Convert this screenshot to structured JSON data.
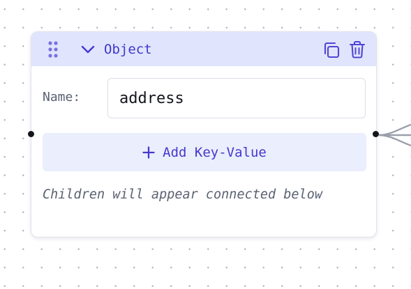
{
  "node": {
    "type_label": "Object",
    "name_label": "Name:",
    "name_value": "address",
    "add_button_label": "Add Key-Value",
    "hint": "Children will appear connected below"
  },
  "icons": {
    "drag": "drag-dots-icon",
    "collapse": "chevron-down-icon",
    "duplicate": "copy-icon",
    "delete": "trash-icon",
    "add": "plus-icon"
  },
  "colors": {
    "header_bg": "#e0e5fd",
    "accent": "#3f37c9",
    "button_bg": "#eaeefd",
    "edge": "#9a9fab"
  }
}
